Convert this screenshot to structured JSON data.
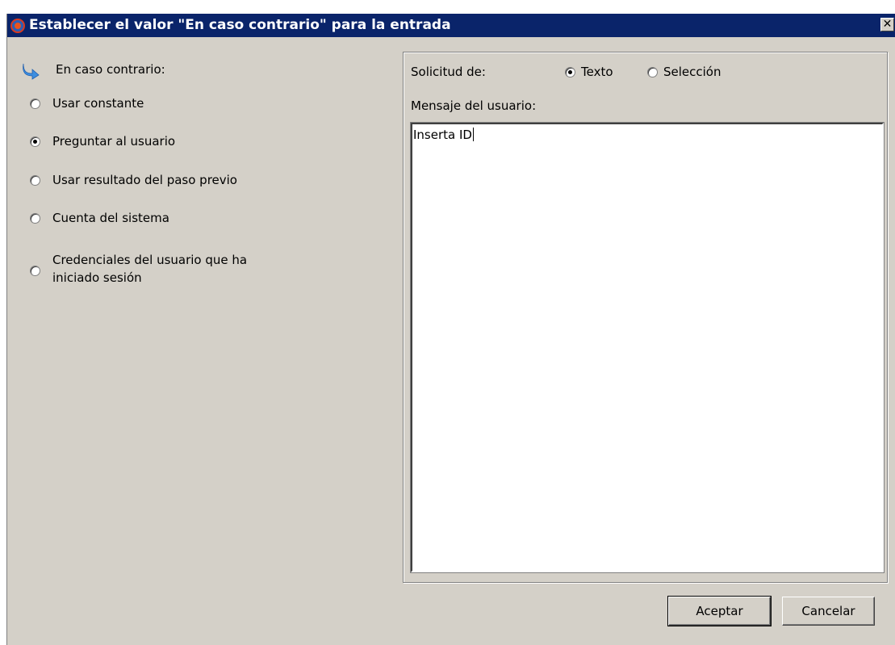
{
  "window": {
    "title": "Establecer el valor \"En caso contrario\" para la entrada",
    "close_label": "✕"
  },
  "left": {
    "header": "En caso contrario:",
    "options": [
      {
        "label": "Usar constante",
        "selected": false
      },
      {
        "label": "Preguntar al usuario",
        "selected": true
      },
      {
        "label": "Usar resultado del paso previo",
        "selected": false
      },
      {
        "label": "Cuenta del sistema",
        "selected": false
      },
      {
        "label_line1": "Credenciales del usuario que ha",
        "label_line2": "iniciado sesión",
        "selected": false
      }
    ]
  },
  "right": {
    "request_label": "Solicitud de:",
    "request_options": [
      {
        "label": "Texto",
        "selected": true
      },
      {
        "label": "Selección",
        "selected": false
      }
    ],
    "message_label": "Mensaje del usuario:",
    "message_value": "Inserta ID"
  },
  "buttons": {
    "ok": "Aceptar",
    "cancel": "Cancelar"
  },
  "colors": {
    "titlebar": "#0a246a",
    "window_bg": "#d4d0c8",
    "arrow_icon": "#3d8ee0"
  }
}
